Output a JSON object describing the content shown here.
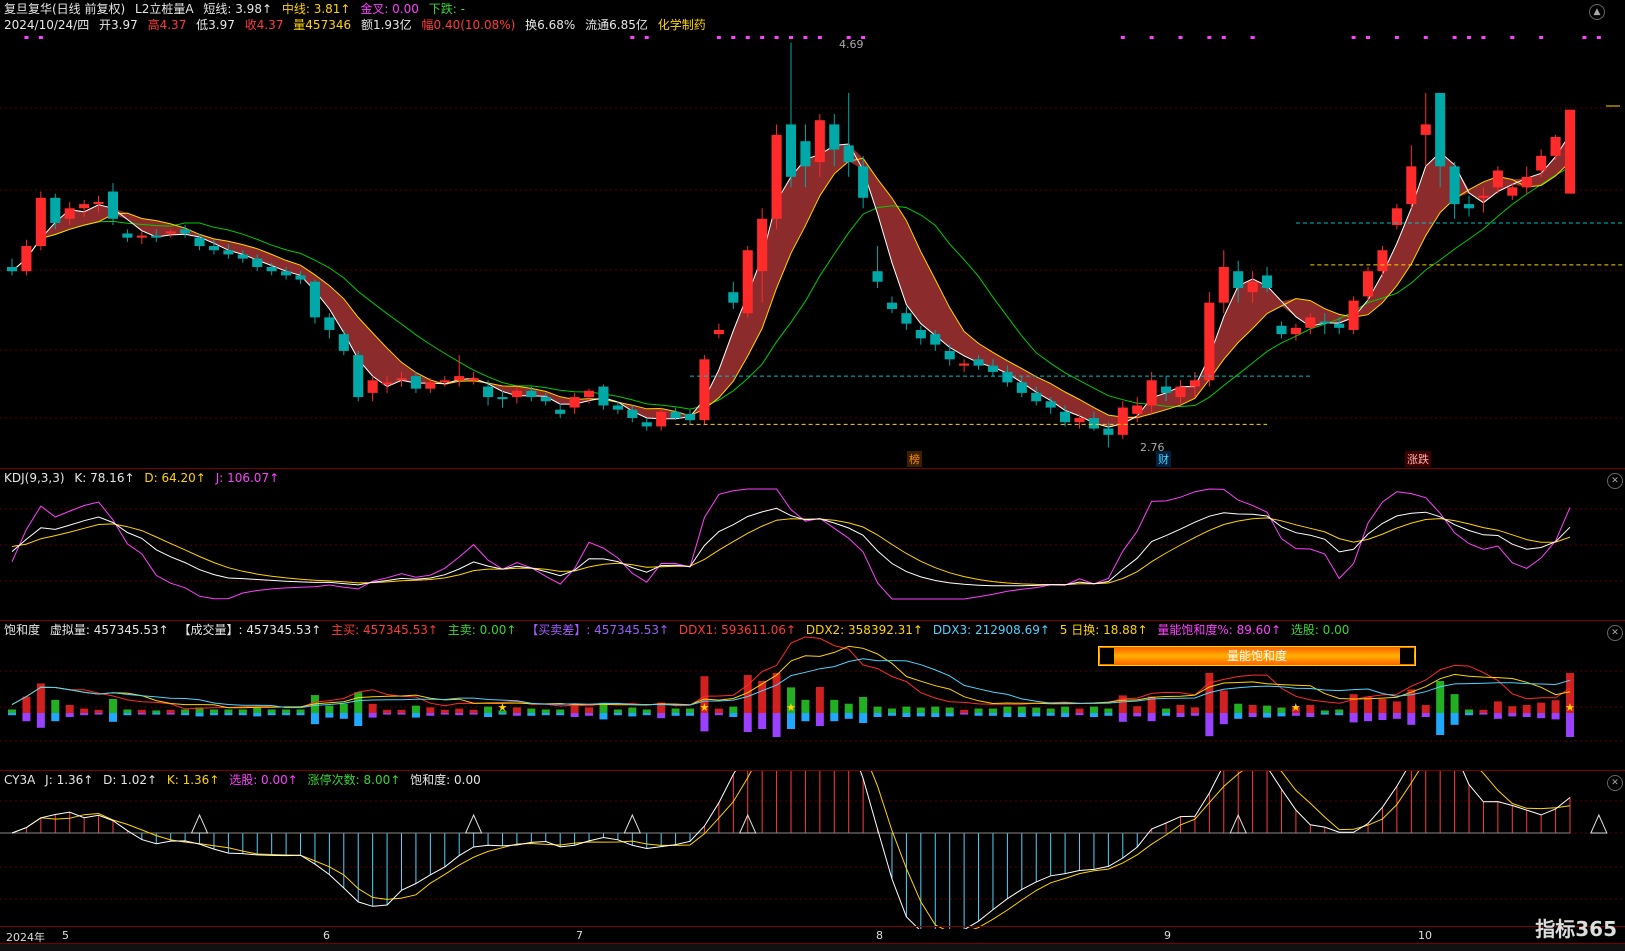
{
  "main": {
    "title": "复旦复华(日线 前复权)",
    "indicator": "L2立桩量A",
    "short": "短线: 3.98↑",
    "mid": "中线: 3.81↑",
    "golden": "金叉: 0.00",
    "down": "下跌: -",
    "date": "2024/10/24/四",
    "open": "开3.97",
    "high": "高4.37",
    "low": "低3.97",
    "close": "收4.37",
    "vol": "量457346",
    "amount": "额1.93亿",
    "change": "幅0.40(10.08%)",
    "turnover": "换6.68%",
    "float": "流通6.85亿",
    "sector": "化学制药",
    "high_label": "4.69",
    "low_label": "2.76",
    "tags": [
      "榜",
      "财",
      "涨跌"
    ]
  },
  "kdj": {
    "name": "KDJ(9,3,3)",
    "k": "K: 78.16↑",
    "d": "D: 64.20↑",
    "j": "J: 106.07↑"
  },
  "sat": {
    "name": "饱和度",
    "virtual": "虚拟量: 457345.53↑",
    "volume": "【成交量】: 457345.53↑",
    "buy": "主买: 457345.53↑",
    "sell": "主卖: 0.00↑",
    "diff": "【买卖差】: 457345.53↑",
    "ddx1": "DDX1: 593611.06↑",
    "ddx2": "DDX2: 358392.31↑",
    "ddx3": "DDX3: 212908.69↑",
    "turn5": "5 日换: 18.88↑",
    "satpct": "量能饱和度%: 89.60↑",
    "pick": "选股: 0.00",
    "banner": "量能饱和度"
  },
  "cy3a": {
    "name": "CY3A",
    "j": "J: 1.36↑",
    "d": "D: 1.02↑",
    "k": "K: 1.36↑",
    "pick": "选股: 0.00↑",
    "limit": "涨停次数: 8.00↑",
    "sat": "饱和度: 0.00"
  },
  "xaxis": [
    "2024年",
    "5",
    "6",
    "7",
    "8",
    "9",
    "10"
  ],
  "logo": "指标365",
  "colors": {
    "up": "#ff2b2b",
    "down": "#00a8a8",
    "ribbon": "#9b3030",
    "short": "#ffffff",
    "mid": "#ffd400",
    "long": "#00cc00"
  },
  "chart_data": {
    "type": "candlestick",
    "ohlc": [
      [
        3.62,
        3.66,
        3.58,
        3.6
      ],
      [
        3.6,
        3.75,
        3.58,
        3.72
      ],
      [
        3.72,
        3.98,
        3.7,
        3.95
      ],
      [
        3.95,
        3.97,
        3.8,
        3.83
      ],
      [
        3.85,
        3.93,
        3.82,
        3.9
      ],
      [
        3.9,
        3.94,
        3.86,
        3.92
      ],
      [
        3.92,
        3.96,
        3.88,
        3.93
      ],
      [
        3.98,
        4.02,
        3.82,
        3.85
      ],
      [
        3.78,
        3.8,
        3.74,
        3.76
      ],
      [
        3.76,
        3.79,
        3.73,
        3.77
      ],
      [
        3.77,
        3.8,
        3.74,
        3.76
      ],
      [
        3.78,
        3.8,
        3.76,
        3.79
      ],
      [
        3.8,
        3.82,
        3.76,
        3.78
      ],
      [
        3.76,
        3.78,
        3.7,
        3.72
      ],
      [
        3.72,
        3.75,
        3.68,
        3.7
      ],
      [
        3.7,
        3.73,
        3.66,
        3.68
      ],
      [
        3.68,
        3.7,
        3.64,
        3.66
      ],
      [
        3.66,
        3.68,
        3.6,
        3.62
      ],
      [
        3.62,
        3.64,
        3.58,
        3.6
      ],
      [
        3.6,
        3.62,
        3.56,
        3.58
      ],
      [
        3.58,
        3.6,
        3.54,
        3.56
      ],
      [
        3.55,
        3.56,
        3.35,
        3.38
      ],
      [
        3.38,
        3.4,
        3.28,
        3.32
      ],
      [
        3.3,
        3.32,
        3.2,
        3.22
      ],
      [
        3.2,
        3.22,
        2.98,
        3.0
      ],
      [
        3.02,
        3.1,
        2.98,
        3.08
      ],
      [
        3.06,
        3.1,
        3.02,
        3.07
      ],
      [
        3.08,
        3.12,
        3.05,
        3.09
      ],
      [
        3.1,
        3.12,
        3.02,
        3.04
      ],
      [
        3.04,
        3.09,
        3.02,
        3.07
      ],
      [
        3.07,
        3.1,
        3.05,
        3.08
      ],
      [
        3.08,
        3.2,
        3.05,
        3.1
      ],
      [
        3.08,
        3.12,
        3.06,
        3.09
      ],
      [
        3.05,
        3.08,
        2.96,
        3.0
      ],
      [
        3.0,
        3.03,
        2.95,
        2.99
      ],
      [
        3.0,
        3.05,
        2.97,
        3.03
      ],
      [
        3.03,
        3.05,
        2.98,
        3.0
      ],
      [
        3.0,
        3.02,
        2.96,
        2.98
      ],
      [
        2.94,
        2.97,
        2.9,
        2.92
      ],
      [
        2.95,
        3.02,
        2.92,
        3.0
      ],
      [
        3.0,
        3.04,
        2.97,
        3.03
      ],
      [
        3.05,
        3.06,
        2.94,
        2.96
      ],
      [
        2.96,
        2.98,
        2.92,
        2.94
      ],
      [
        2.94,
        2.96,
        2.88,
        2.9
      ],
      [
        2.88,
        2.9,
        2.84,
        2.86
      ],
      [
        2.86,
        2.95,
        2.84,
        2.93
      ],
      [
        2.93,
        2.95,
        2.89,
        2.9
      ],
      [
        2.92,
        2.94,
        2.87,
        2.89
      ],
      [
        2.89,
        3.2,
        2.87,
        3.18
      ],
      [
        3.3,
        3.35,
        3.28,
        3.32
      ],
      [
        3.5,
        3.55,
        3.42,
        3.45
      ],
      [
        3.4,
        3.72,
        3.38,
        3.7
      ],
      [
        3.6,
        3.9,
        3.45,
        3.85
      ],
      [
        3.85,
        4.3,
        3.8,
        4.25
      ],
      [
        4.3,
        4.69,
        4.0,
        4.05
      ],
      [
        4.22,
        4.3,
        4.0,
        4.1
      ],
      [
        4.12,
        4.35,
        4.05,
        4.32
      ],
      [
        4.3,
        4.35,
        4.1,
        4.18
      ],
      [
        4.2,
        4.45,
        4.05,
        4.12
      ],
      [
        4.1,
        4.15,
        3.9,
        3.95
      ],
      [
        3.6,
        3.72,
        3.52,
        3.55
      ],
      [
        3.45,
        3.48,
        3.4,
        3.42
      ],
      [
        3.4,
        3.43,
        3.32,
        3.35
      ],
      [
        3.32,
        3.34,
        3.25,
        3.28
      ],
      [
        3.3,
        3.32,
        3.22,
        3.25
      ],
      [
        3.22,
        3.25,
        3.15,
        3.18
      ],
      [
        3.15,
        3.18,
        3.12,
        3.16
      ],
      [
        3.18,
        3.2,
        3.13,
        3.15
      ],
      [
        3.15,
        3.18,
        3.1,
        3.12
      ],
      [
        3.12,
        3.15,
        3.05,
        3.07
      ],
      [
        3.07,
        3.1,
        3.0,
        3.02
      ],
      [
        3.02,
        3.05,
        2.96,
        2.98
      ],
      [
        2.98,
        3.0,
        2.92,
        2.95
      ],
      [
        2.93,
        2.96,
        2.86,
        2.88
      ],
      [
        2.88,
        2.92,
        2.85,
        2.9
      ],
      [
        2.9,
        2.93,
        2.84,
        2.85
      ],
      [
        2.85,
        2.88,
        2.76,
        2.82
      ],
      [
        2.82,
        2.98,
        2.8,
        2.95
      ],
      [
        2.92,
        3.0,
        2.88,
        2.96
      ],
      [
        2.96,
        3.12,
        2.92,
        3.08
      ],
      [
        3.05,
        3.1,
        2.98,
        3.02
      ],
      [
        3.0,
        3.08,
        2.97,
        3.05
      ],
      [
        3.05,
        3.12,
        3.0,
        3.08
      ],
      [
        3.08,
        3.5,
        3.05,
        3.45
      ],
      [
        3.45,
        3.7,
        3.4,
        3.62
      ],
      [
        3.6,
        3.65,
        3.45,
        3.52
      ],
      [
        3.5,
        3.6,
        3.45,
        3.55
      ],
      [
        3.58,
        3.62,
        3.5,
        3.52
      ],
      [
        3.34,
        3.36,
        3.28,
        3.3
      ],
      [
        3.3,
        3.35,
        3.27,
        3.33
      ],
      [
        3.33,
        3.4,
        3.3,
        3.38
      ],
      [
        3.36,
        3.4,
        3.3,
        3.35
      ],
      [
        3.35,
        3.38,
        3.3,
        3.33
      ],
      [
        3.32,
        3.48,
        3.3,
        3.46
      ],
      [
        3.48,
        3.62,
        3.46,
        3.6
      ],
      [
        3.6,
        3.72,
        3.57,
        3.7
      ],
      [
        3.82,
        3.92,
        3.8,
        3.9
      ],
      [
        3.92,
        4.2,
        3.9,
        4.1
      ],
      [
        4.25,
        4.45,
        4.1,
        4.3
      ],
      [
        4.45,
        4.45,
        4.0,
        4.1
      ],
      [
        4.1,
        4.12,
        3.85,
        3.92
      ],
      [
        3.92,
        3.96,
        3.86,
        3.9
      ],
      [
        3.95,
        4.0,
        3.88,
        3.96
      ],
      [
        4.0,
        4.1,
        3.97,
        4.08
      ],
      [
        3.96,
        4.02,
        3.94,
        4.0
      ],
      [
        4.0,
        4.1,
        3.97,
        4.05
      ],
      [
        4.08,
        4.18,
        4.05,
        4.15
      ],
      [
        4.15,
        4.25,
        4.13,
        4.24
      ],
      [
        3.97,
        4.37,
        3.97,
        4.37
      ]
    ],
    "high_mark": 4.69,
    "low_mark": 2.76
  }
}
